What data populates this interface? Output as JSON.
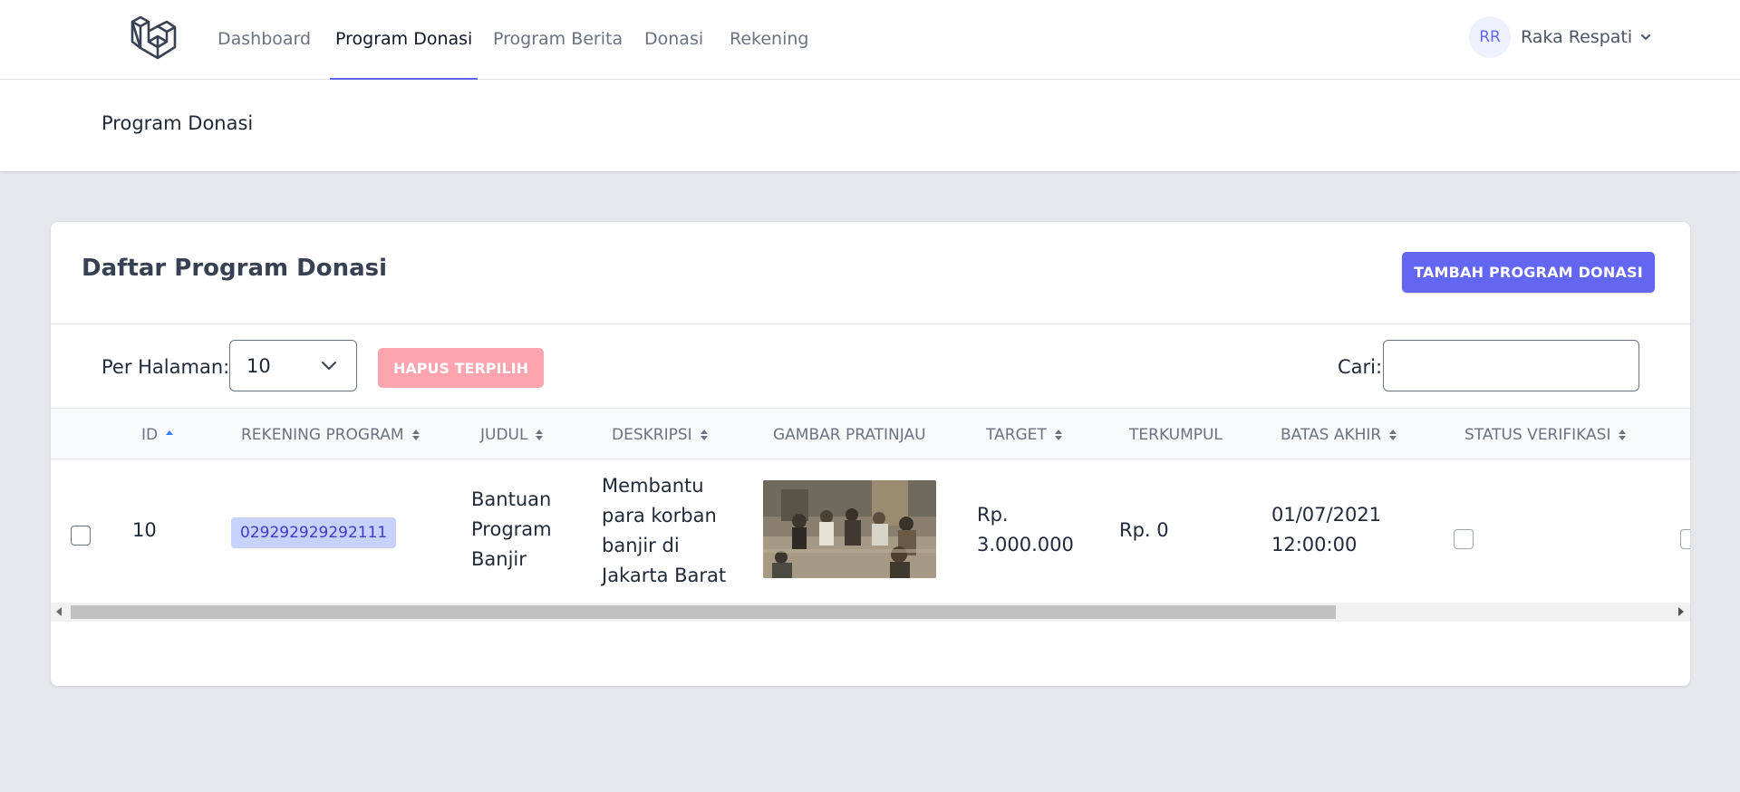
{
  "nav": {
    "items": [
      {
        "label": "Dashboard",
        "active": false
      },
      {
        "label": "Program Donasi",
        "active": true
      },
      {
        "label": "Program Berita",
        "active": false
      },
      {
        "label": "Donasi",
        "active": false
      },
      {
        "label": "Rekening",
        "active": false
      }
    ],
    "user": {
      "initials": "RR",
      "name": "Raka Respati"
    }
  },
  "header": {
    "title": "Program Donasi"
  },
  "card": {
    "title": "Daftar Program Donasi",
    "add_button": "TAMBAH PROGRAM DONASI",
    "per_page_label": "Per Halaman:",
    "per_page_value": "10",
    "delete_selected": "HAPUS TERPILIH",
    "search_label": "Cari:",
    "search_value": ""
  },
  "table": {
    "columns": [
      {
        "label": "ID",
        "sort": "asc"
      },
      {
        "label": "REKENING PROGRAM",
        "sort": "both"
      },
      {
        "label": "JUDUL",
        "sort": "both"
      },
      {
        "label": "DESKRIPSI",
        "sort": "both"
      },
      {
        "label": "GAMBAR PRATINJAU",
        "sort": "none"
      },
      {
        "label": "TARGET",
        "sort": "both"
      },
      {
        "label": "TERKUMPUL",
        "sort": "none"
      },
      {
        "label": "BATAS AKHIR",
        "sort": "both"
      },
      {
        "label": "STATUS VERIFIKASI",
        "sort": "both"
      }
    ],
    "rows": [
      {
        "id": "10",
        "rekening": "029292929292111",
        "judul": [
          "Bantuan",
          "Program",
          "Banjir"
        ],
        "deskripsi": [
          "Membantu",
          "para korban",
          "banjir di",
          "Jakarta Barat"
        ],
        "target": [
          "Rp.",
          "3.000.000"
        ],
        "terkumpul": "Rp. 0",
        "batas_akhir": [
          "01/07/2021",
          "12:00:00"
        ],
        "status_verifikasi": false
      }
    ]
  },
  "colors": {
    "accent": "#6366f1",
    "danger_light": "#fda4af",
    "badge_bg": "#c7d2fe",
    "badge_text": "#4338ca"
  }
}
